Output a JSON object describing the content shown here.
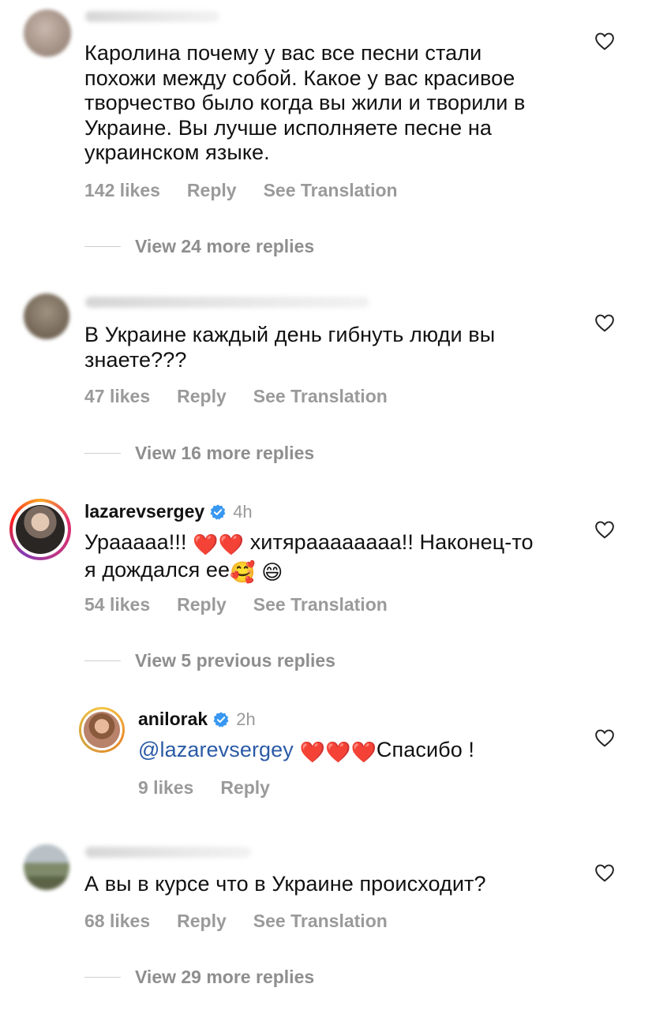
{
  "comments": [
    {
      "text_lines": [
        "Каролина почему у вас все песни стали",
        "похожи между собой. Какое у вас красивое",
        "творчество было когда вы жили и творили в",
        "Украине. Вы лучше исполняете песне на",
        "украинском языке."
      ],
      "likes": "142 likes",
      "reply": "Reply",
      "translate": "See Translation",
      "view_replies": "View 24 more replies"
    },
    {
      "text_lines": [
        "В Украине каждый день гибнуть люди вы",
        "знаете???"
      ],
      "likes": "47 likes",
      "reply": "Reply",
      "translate": "See Translation",
      "view_replies": "View 16 more replies"
    },
    {
      "username": "lazarevsergey",
      "time": "4h",
      "line1_a": "Урааааа!!! ",
      "line1_b": " хитяраааааааа!! Наконец-то",
      "line2_a": "я дождался ее",
      "emoji_hearts": "❤️❤️",
      "emoji_smile_love": "🥰",
      "emoji_grin": "😄",
      "likes": "54 likes",
      "reply": "Reply",
      "translate": "See Translation",
      "view_replies": "View 5 previous replies"
    },
    {
      "username": "anilorak",
      "time": "2h",
      "mention": "@lazarevsergey",
      "emoji_hearts": "❤️❤️❤️",
      "text_after": "Спасибо !",
      "likes": "9 likes",
      "reply": "Reply"
    },
    {
      "text_lines": [
        "А вы в курсе что в Украине происходит?"
      ],
      "likes": "68 likes",
      "reply": "Reply",
      "translate": "See Translation",
      "view_replies": "View 29 more replies"
    }
  ],
  "colors": {
    "text": "#111111",
    "meta": "#9a9a9a",
    "mention": "#2b5aa6",
    "verified": "#3897f0"
  }
}
